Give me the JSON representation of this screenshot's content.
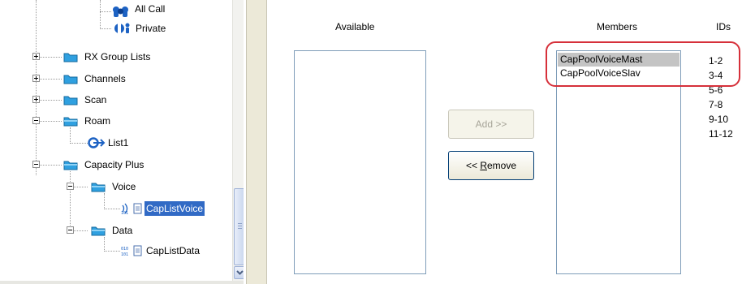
{
  "tree": {
    "items": [
      {
        "label": "All Call",
        "icon": "group-call-icon"
      },
      {
        "label": "Private",
        "icon": "private-call-icon"
      },
      {
        "label": "RX Group Lists",
        "icon": "folder-icon",
        "expander": "plus"
      },
      {
        "label": "Channels",
        "icon": "folder-icon",
        "expander": "plus"
      },
      {
        "label": "Scan",
        "icon": "folder-icon",
        "expander": "plus"
      },
      {
        "label": "Roam",
        "icon": "folder-icon",
        "expander": "minus"
      },
      {
        "label": "List1",
        "icon": "roam-list-icon"
      },
      {
        "label": "Capacity Plus",
        "icon": "folder-icon",
        "expander": "minus"
      },
      {
        "label": "Voice",
        "icon": "folder-icon",
        "expander": "minus"
      },
      {
        "label": "CapListVoice",
        "icon": "voice-list-icon",
        "selected": true
      },
      {
        "label": "Data",
        "icon": "folder-icon",
        "expander": "minus"
      },
      {
        "label": "CapListData",
        "icon": "data-list-icon"
      }
    ]
  },
  "available": {
    "header": "Available",
    "items": []
  },
  "buttons": {
    "add_label": "Add >>",
    "add_enabled": false,
    "remove_prefix": "<< ",
    "remove_underlined": "R",
    "remove_rest": "emove"
  },
  "members": {
    "header": "Members",
    "items": [
      {
        "label": "CapPoolVoiceMast",
        "highlighted": true
      },
      {
        "label": "CapPoolVoiceSlav",
        "highlighted": false
      }
    ]
  },
  "ids": {
    "header": "IDs",
    "values": [
      "1-2",
      "3-4",
      "5-6",
      "7-8",
      "9-10",
      "11-12"
    ]
  },
  "colors": {
    "selection": "#316ac5",
    "callout": "#d6303a",
    "folder": "#2fa0e0"
  }
}
